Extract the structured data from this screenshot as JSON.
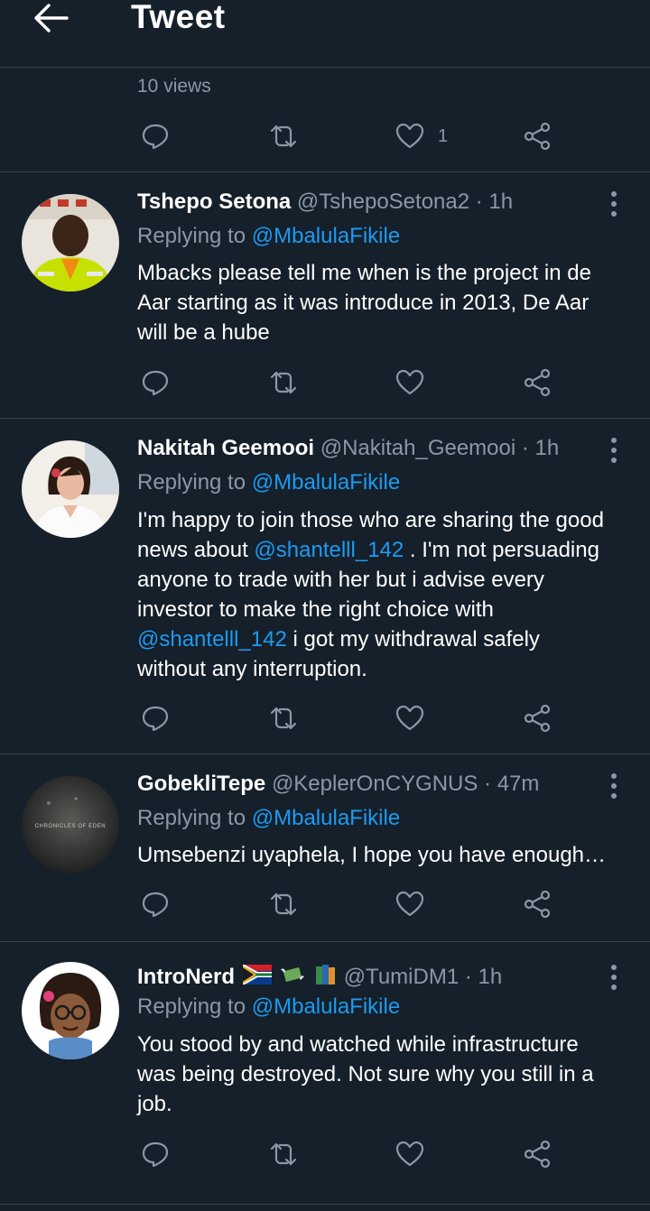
{
  "header": {
    "title": "Tweet",
    "back_icon": "arrow-left-icon"
  },
  "main_tweet": {
    "views": "10 views",
    "like_count": "1"
  },
  "colors": {
    "background": "#15202b",
    "text": "#ffffff",
    "muted": "#8b98a5",
    "accent": "#1d9bf0",
    "divider": "#38444d"
  },
  "replies": [
    {
      "name": "Tshepo Setona",
      "handle": "@TshepoSetona2 · 1h",
      "replying_prefix": "Replying to",
      "replying_to": "@MbalulaFikile",
      "lines": [
        "Mbacks please tell me when is the project in de",
        "Aar starting as it was introduce in 2013, De Aar",
        "will be a hube"
      ]
    },
    {
      "name": "Nakitah Geemooi",
      "handle": "@Nakitah_Geemooi · 1h",
      "replying_prefix": "Replying to",
      "replying_to": "@MbalulaFikile",
      "line1": "I'm happy to join those who are sharing the good",
      "line2_a": "news about ",
      "line2_mention": "@shantelll_142",
      "line2_b": " . I'm not persuading",
      "line3": "anyone to trade with her but i advise every",
      "line4": "investor to make the right choice with",
      "line5_mention": "@shantelll_142",
      "line5_b": " i got my withdrawal safely",
      "line6": "without any interruption."
    },
    {
      "name": "GobekliTepe",
      "handle": "@KeplerOnCYGNUS · 47m",
      "replying_prefix": "Replying to",
      "replying_to": "@MbalulaFikile",
      "lines": [
        "Umsebenzi uyaphela, I hope you have enough…"
      ],
      "avatar_text": "CHRONICLES OF EDEN"
    },
    {
      "name": "IntroNerd",
      "handle": "@TumiDM1 · 1h",
      "replying_prefix": "Replying to",
      "replying_to": "@MbalulaFikile",
      "lines": [
        "You stood by and watched while infrastructure",
        "was being destroyed. Not sure why you still in a",
        "job."
      ],
      "emoji_icons": [
        "south-africa-flag-icon",
        "money-with-wings-icon",
        "books-icon"
      ]
    }
  ]
}
